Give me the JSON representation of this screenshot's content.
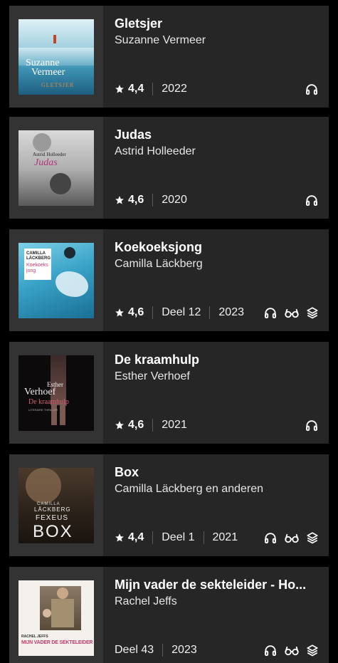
{
  "books": [
    {
      "title": "Gletsjer",
      "author": "Suzanne Vermeer",
      "rating": "4,4",
      "part": "",
      "year": "2022",
      "formats": [
        "headphones-icon"
      ],
      "cover": {
        "author_line1": "Suzanne",
        "author_line2": "Vermeer",
        "title": "GLETSJER"
      }
    },
    {
      "title": "Judas",
      "author": "Astrid Holleeder",
      "rating": "4,6",
      "part": "",
      "year": "2020",
      "formats": [
        "headphones-icon"
      ],
      "cover": {
        "author": "Astrid Holleeder",
        "title": "Judas"
      }
    },
    {
      "title": "Koekoeksjong",
      "author": "Camilla Läckberg",
      "rating": "4,6",
      "part": "Deel 12",
      "year": "2023",
      "formats": [
        "headphones-icon",
        "glasses-icon",
        "layers-icon"
      ],
      "cover": {
        "author_line1": "CAMILLA",
        "author_line2": "LÄCKBERG",
        "title_line1": "Koekoeks",
        "title_line2": "jong"
      }
    },
    {
      "title": "De kraamhulp",
      "author": "Esther Verhoef",
      "rating": "4,6",
      "part": "",
      "year": "2021",
      "formats": [
        "headphones-icon"
      ],
      "cover": {
        "author_line1": "Esther",
        "author_line2": "Verhoef",
        "title": "De kraamhulp",
        "subtitle": "LITERAIRE THRILLER"
      }
    },
    {
      "title": "Box",
      "author": "Camilla Läckberg en anderen",
      "rating": "4,4",
      "part": "Deel 1",
      "year": "2021",
      "formats": [
        "headphones-icon",
        "glasses-icon",
        "layers-icon"
      ],
      "cover": {
        "author_line1": "CAMILLA",
        "author_line2": "LÄCKBERG",
        "author_line3": "FEXEUS",
        "title": "BOX"
      }
    },
    {
      "title": "Mijn vader de sekteleider - Ho...",
      "author": "Rachel Jeffs",
      "rating": "",
      "part": "Deel 43",
      "year": "2023",
      "formats": [
        "headphones-icon",
        "glasses-icon",
        "layers-icon"
      ],
      "cover": {
        "author": "RACHEL JEFFS",
        "title": "MIJN VADER DE SEKTELEIDER"
      }
    }
  ]
}
